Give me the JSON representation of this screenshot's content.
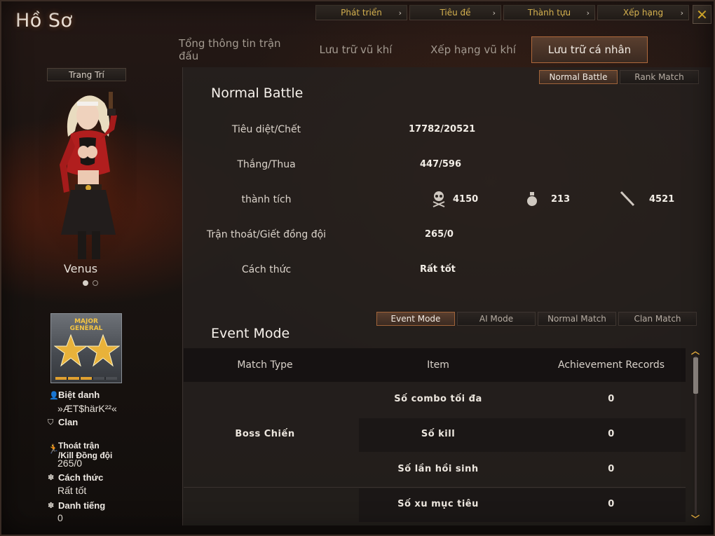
{
  "app_title": "Hồ Sơ",
  "top_buttons": [
    {
      "label": "Phát triển"
    },
    {
      "label": "Tiêu đề"
    },
    {
      "label": "Thành tựu"
    },
    {
      "label": "Xếp hạng"
    }
  ],
  "close_glyph": "✕",
  "main_tabs": [
    {
      "label": "Tổng thông tin trận đấu",
      "active": false
    },
    {
      "label": "Lưu trữ vũ khí",
      "active": false
    },
    {
      "label": "Xếp hạng vũ khí",
      "active": false
    },
    {
      "label": "Lưu trữ cá nhân",
      "active": true
    }
  ],
  "sidebar": {
    "decor_label": "Trang Trí",
    "character_name": "Venus",
    "carousel": {
      "count": 2,
      "active": 0
    },
    "rank": {
      "line1": "MAJOR",
      "line2": "GENERAL",
      "stars": 2,
      "progress_segments": 5,
      "progress_filled": 3
    },
    "nickname_label": "Biệt danh",
    "nickname_value": "»ÆT$härK²²«",
    "clan_label": "Clan",
    "quit_label_1": "Thoát trận",
    "quit_label_2": "/Kill Đồng đội",
    "quit_value": "265/0",
    "manner_label": "Cách thức",
    "manner_value": "Rất tốt",
    "fame_label": "Danh tiếng",
    "fame_value": "0"
  },
  "battle_tabs": [
    {
      "label": "Normal Battle",
      "active": true
    },
    {
      "label": "Rank Match",
      "active": false
    }
  ],
  "normal_battle": {
    "title": "Normal Battle",
    "kd_label": "Tiêu diệt/Chết",
    "kd_value": "17782/20521",
    "wl_label": "Thắng/Thua",
    "wl_value": "447/596",
    "ach_label": "thành tích",
    "ach_headshot": "4150",
    "ach_grenade": "213",
    "ach_knife": "4521",
    "quit_label": "Trận thoát/Giết đồng đội",
    "quit_value": "265/0",
    "manner_label": "Cách thức",
    "manner_value": "Rất tốt"
  },
  "mode_tabs": [
    {
      "label": "Event Mode",
      "active": true
    },
    {
      "label": "AI Mode",
      "active": false
    },
    {
      "label": "Normal Match",
      "active": false
    },
    {
      "label": "Clan Match",
      "active": false
    }
  ],
  "event_mode": {
    "title": "Event Mode",
    "headers": [
      "Match Type",
      "Item",
      "Achievement Records"
    ],
    "group_name": "Boss Chiến",
    "rows": [
      {
        "item": "Số combo tối đa",
        "value": "0"
      },
      {
        "item": "Số kill",
        "value": "0"
      },
      {
        "item": "Số lần hồi sinh",
        "value": "0"
      },
      {
        "item": "Số xu mục tiêu",
        "value": "0"
      }
    ]
  }
}
